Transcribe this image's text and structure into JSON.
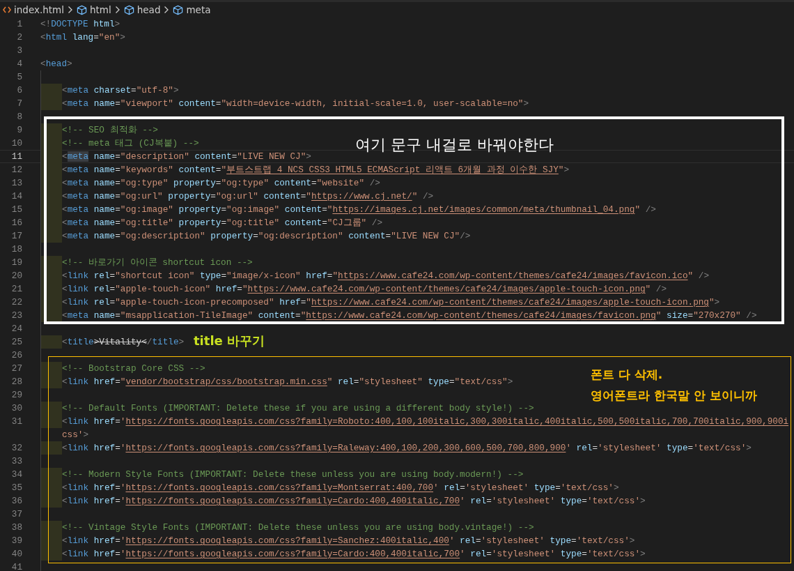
{
  "breadcrumb": [
    {
      "kind": "file",
      "label": "index.html"
    },
    {
      "kind": "element",
      "label": "html"
    },
    {
      "kind": "element",
      "label": "head"
    },
    {
      "kind": "element",
      "label": "meta"
    }
  ],
  "lines": [
    {
      "number": "1",
      "current": false,
      "indented": false,
      "tokens": [
        {
          "kind": "p",
          "text": "<!"
        },
        {
          "kind": "tag",
          "text": "DOCTYPE"
        },
        {
          "kind": "attr",
          "text": " html"
        },
        {
          "kind": "p",
          "text": ">"
        }
      ]
    },
    {
      "number": "2",
      "current": false,
      "indented": false,
      "tokens": [
        {
          "kind": "p",
          "text": "<"
        },
        {
          "kind": "tag",
          "text": "html"
        },
        {
          "kind": "attr",
          "text": " lang"
        },
        {
          "kind": "eq",
          "text": "="
        },
        {
          "kind": "str",
          "text": "\"en\""
        },
        {
          "kind": "p",
          "text": ">"
        }
      ]
    },
    {
      "number": "3",
      "current": false,
      "indented": false
    },
    {
      "number": "4",
      "current": false,
      "indented": false,
      "tokens": [
        {
          "kind": "p",
          "text": "<"
        },
        {
          "kind": "tag",
          "text": "head"
        },
        {
          "kind": "p",
          "text": ">"
        }
      ]
    },
    {
      "number": "5",
      "current": false,
      "indented": false
    },
    {
      "number": "6",
      "current": false,
      "indented": true,
      "tokens": [
        {
          "kind": "p",
          "text": "<"
        },
        {
          "kind": "tag",
          "text": "meta"
        },
        {
          "kind": "attr",
          "text": " charset"
        },
        {
          "kind": "eq",
          "text": "="
        },
        {
          "kind": "str",
          "text": "\"utf-8\""
        },
        {
          "kind": "p",
          "text": ">"
        }
      ]
    },
    {
      "number": "7",
      "current": false,
      "indented": true,
      "tokens": [
        {
          "kind": "p",
          "text": "<"
        },
        {
          "kind": "tag",
          "text": "meta"
        },
        {
          "kind": "attr",
          "text": " name"
        },
        {
          "kind": "eq",
          "text": "="
        },
        {
          "kind": "str",
          "text": "\"viewport\""
        },
        {
          "kind": "attr",
          "text": " content"
        },
        {
          "kind": "eq",
          "text": "="
        },
        {
          "kind": "str",
          "text": "\"width=device-width, initial-scale=1.0, user-scalable=no\""
        },
        {
          "kind": "p",
          "text": ">"
        }
      ]
    },
    {
      "number": "8",
      "current": false,
      "indented": false
    },
    {
      "number": "9",
      "current": false,
      "indented": true,
      "tokens": [
        {
          "kind": "com",
          "text": "<!-- SEO 최적화 -->"
        }
      ]
    },
    {
      "number": "10",
      "current": false,
      "indented": true,
      "tokens": [
        {
          "kind": "com",
          "text": "<!-- meta 태그 (CJ복붙) -->"
        }
      ]
    },
    {
      "number": "11",
      "current": true,
      "indented": true,
      "tokens": [
        {
          "kind": "p",
          "text": "<"
        },
        {
          "kind": "match",
          "text": "meta"
        },
        {
          "kind": "attr",
          "text": " name"
        },
        {
          "kind": "eq",
          "text": "="
        },
        {
          "kind": "str",
          "text": "\"description\""
        },
        {
          "kind": "attr",
          "text": " content"
        },
        {
          "kind": "eq",
          "text": "="
        },
        {
          "kind": "str",
          "text": "\"LIVE NEW CJ\""
        },
        {
          "kind": "p",
          "text": ">"
        }
      ]
    },
    {
      "number": "12",
      "current": false,
      "indented": true,
      "tokens": [
        {
          "kind": "p",
          "text": "<"
        },
        {
          "kind": "tag",
          "text": "meta"
        },
        {
          "kind": "attr",
          "text": " name"
        },
        {
          "kind": "eq",
          "text": "="
        },
        {
          "kind": "str",
          "text": "\"keywords\""
        },
        {
          "kind": "attr",
          "text": " content"
        },
        {
          "kind": "eq",
          "text": "="
        },
        {
          "kind": "str",
          "text": "\""
        },
        {
          "kind": "link",
          "text": "부트스트랩 4 NCS CSS3 HTML5 ECMAScript 리액트 6개월 과정 이수한 SJY"
        },
        {
          "kind": "str",
          "text": "\""
        },
        {
          "kind": "p",
          "text": ">"
        }
      ]
    },
    {
      "number": "13",
      "current": false,
      "indented": true,
      "tokens": [
        {
          "kind": "p",
          "text": "<"
        },
        {
          "kind": "tag",
          "text": "meta"
        },
        {
          "kind": "attr",
          "text": " name"
        },
        {
          "kind": "eq",
          "text": "="
        },
        {
          "kind": "str",
          "text": "\"og:type\""
        },
        {
          "kind": "attr",
          "text": " property"
        },
        {
          "kind": "eq",
          "text": "="
        },
        {
          "kind": "str",
          "text": "\"og:type\""
        },
        {
          "kind": "attr",
          "text": " content"
        },
        {
          "kind": "eq",
          "text": "="
        },
        {
          "kind": "str",
          "text": "\"website\""
        },
        {
          "kind": "p",
          "text": " />"
        }
      ]
    },
    {
      "number": "14",
      "current": false,
      "indented": true,
      "tokens": [
        {
          "kind": "p",
          "text": "<"
        },
        {
          "kind": "tag",
          "text": "meta"
        },
        {
          "kind": "attr",
          "text": " name"
        },
        {
          "kind": "eq",
          "text": "="
        },
        {
          "kind": "str",
          "text": "\"og:url\""
        },
        {
          "kind": "attr",
          "text": " property"
        },
        {
          "kind": "eq",
          "text": "="
        },
        {
          "kind": "str",
          "text": "\"og:url\""
        },
        {
          "kind": "attr",
          "text": " content"
        },
        {
          "kind": "eq",
          "text": "="
        },
        {
          "kind": "str",
          "text": "\""
        },
        {
          "kind": "link",
          "text": "https://www.cj.net/"
        },
        {
          "kind": "str",
          "text": "\""
        },
        {
          "kind": "p",
          "text": " />"
        }
      ]
    },
    {
      "number": "15",
      "current": false,
      "indented": true,
      "tokens": [
        {
          "kind": "p",
          "text": "<"
        },
        {
          "kind": "tag",
          "text": "meta"
        },
        {
          "kind": "attr",
          "text": " name"
        },
        {
          "kind": "eq",
          "text": "="
        },
        {
          "kind": "str",
          "text": "\"og:image\""
        },
        {
          "kind": "attr",
          "text": " property"
        },
        {
          "kind": "eq",
          "text": "="
        },
        {
          "kind": "str",
          "text": "\"og:image\""
        },
        {
          "kind": "attr",
          "text": " content"
        },
        {
          "kind": "eq",
          "text": "="
        },
        {
          "kind": "str",
          "text": "\""
        },
        {
          "kind": "link",
          "text": "https://images.cj.net/images/common/meta/thumbnail_04.png"
        },
        {
          "kind": "str",
          "text": "\""
        },
        {
          "kind": "p",
          "text": " />"
        }
      ]
    },
    {
      "number": "16",
      "current": false,
      "indented": true,
      "tokens": [
        {
          "kind": "p",
          "text": "<"
        },
        {
          "kind": "tag",
          "text": "meta"
        },
        {
          "kind": "attr",
          "text": " name"
        },
        {
          "kind": "eq",
          "text": "="
        },
        {
          "kind": "str",
          "text": "\"og:title\""
        },
        {
          "kind": "attr",
          "text": " property"
        },
        {
          "kind": "eq",
          "text": "="
        },
        {
          "kind": "str",
          "text": "\"og:title\""
        },
        {
          "kind": "attr",
          "text": " content"
        },
        {
          "kind": "eq",
          "text": "="
        },
        {
          "kind": "str",
          "text": "\"CJ그룹\""
        },
        {
          "kind": "p",
          "text": " />"
        }
      ]
    },
    {
      "number": "17",
      "current": false,
      "indented": true,
      "tokens": [
        {
          "kind": "p",
          "text": "<"
        },
        {
          "kind": "tag",
          "text": "meta"
        },
        {
          "kind": "attr",
          "text": " name"
        },
        {
          "kind": "eq",
          "text": "="
        },
        {
          "kind": "str",
          "text": "\"og:description\""
        },
        {
          "kind": "attr",
          "text": " property"
        },
        {
          "kind": "eq",
          "text": "="
        },
        {
          "kind": "str",
          "text": "\"og:description\""
        },
        {
          "kind": "attr",
          "text": " content"
        },
        {
          "kind": "eq",
          "text": "="
        },
        {
          "kind": "str",
          "text": "\"LIVE NEW CJ\""
        },
        {
          "kind": "p",
          "text": "/>"
        }
      ]
    },
    {
      "number": "18",
      "current": false,
      "indented": false
    },
    {
      "number": "19",
      "current": false,
      "indented": true,
      "tokens": [
        {
          "kind": "com",
          "text": "<!-- 바로가기 아이콘 shortcut icon -->"
        }
      ]
    },
    {
      "number": "20",
      "current": false,
      "indented": true,
      "tokens": [
        {
          "kind": "p",
          "text": "<"
        },
        {
          "kind": "tag",
          "text": "link"
        },
        {
          "kind": "attr",
          "text": " rel"
        },
        {
          "kind": "eq",
          "text": "="
        },
        {
          "kind": "str",
          "text": "\"shortcut icon\""
        },
        {
          "kind": "attr",
          "text": " type"
        },
        {
          "kind": "eq",
          "text": "="
        },
        {
          "kind": "str",
          "text": "\"image/x-icon\""
        },
        {
          "kind": "attr",
          "text": " href"
        },
        {
          "kind": "eq",
          "text": "="
        },
        {
          "kind": "str",
          "text": "\""
        },
        {
          "kind": "link",
          "text": "https://www.cafe24.com/wp-content/themes/cafe24/images/favicon.ico"
        },
        {
          "kind": "str",
          "text": "\""
        },
        {
          "kind": "p",
          "text": " />"
        }
      ]
    },
    {
      "number": "21",
      "current": false,
      "indented": true,
      "tokens": [
        {
          "kind": "p",
          "text": "<"
        },
        {
          "kind": "tag",
          "text": "link"
        },
        {
          "kind": "attr",
          "text": " rel"
        },
        {
          "kind": "eq",
          "text": "="
        },
        {
          "kind": "str",
          "text": "\"apple-touch-icon\""
        },
        {
          "kind": "attr",
          "text": " href"
        },
        {
          "kind": "eq",
          "text": "="
        },
        {
          "kind": "str",
          "text": "\""
        },
        {
          "kind": "link",
          "text": "https://www.cafe24.com/wp-content/themes/cafe24/images/apple-touch-icon.png"
        },
        {
          "kind": "str",
          "text": "\""
        },
        {
          "kind": "p",
          "text": " />"
        }
      ]
    },
    {
      "number": "22",
      "current": false,
      "indented": true,
      "tokens": [
        {
          "kind": "p",
          "text": "<"
        },
        {
          "kind": "tag",
          "text": "link"
        },
        {
          "kind": "attr",
          "text": " rel"
        },
        {
          "kind": "eq",
          "text": "="
        },
        {
          "kind": "str",
          "text": "\"apple-touch-icon-precomposed\""
        },
        {
          "kind": "attr",
          "text": " href"
        },
        {
          "kind": "eq",
          "text": "="
        },
        {
          "kind": "str",
          "text": "\""
        },
        {
          "kind": "link",
          "text": "https://www.cafe24.com/wp-content/themes/cafe24/images/apple-touch-icon.png"
        },
        {
          "kind": "str",
          "text": "\""
        },
        {
          "kind": "p",
          "text": ">"
        }
      ]
    },
    {
      "number": "23",
      "current": false,
      "indented": true,
      "tokens": [
        {
          "kind": "p",
          "text": "<"
        },
        {
          "kind": "tag",
          "text": "meta"
        },
        {
          "kind": "attr",
          "text": " name"
        },
        {
          "kind": "eq",
          "text": "="
        },
        {
          "kind": "str",
          "text": "\"msapplication-TileImage\""
        },
        {
          "kind": "attr",
          "text": " content"
        },
        {
          "kind": "eq",
          "text": "="
        },
        {
          "kind": "str",
          "text": "\""
        },
        {
          "kind": "link",
          "text": "https://www.cafe24.com/wp-content/themes/cafe24/images/favicon.png"
        },
        {
          "kind": "str",
          "text": "\""
        },
        {
          "kind": "attr",
          "text": " size"
        },
        {
          "kind": "eq",
          "text": "="
        },
        {
          "kind": "str",
          "text": "\"270x270\""
        },
        {
          "kind": "p",
          "text": " />"
        }
      ]
    },
    {
      "number": "24",
      "current": false,
      "indented": false
    },
    {
      "number": "25",
      "current": false,
      "indented": true,
      "tokens": [
        {
          "kind": "p",
          "text": "<"
        },
        {
          "kind": "tag",
          "text": "title"
        },
        {
          "kind": "strike",
          "text": ">Vitality<"
        },
        {
          "kind": "p",
          "text": "/"
        },
        {
          "kind": "tag",
          "text": "title"
        },
        {
          "kind": "p",
          "text": ">"
        }
      ]
    },
    {
      "number": "26",
      "current": false,
      "indented": false
    },
    {
      "number": "27",
      "current": false,
      "indented": true,
      "tokens": [
        {
          "kind": "com",
          "text": "<!-- Bootstrap Core CSS -->"
        }
      ]
    },
    {
      "number": "28",
      "current": false,
      "indented": true,
      "tokens": [
        {
          "kind": "p",
          "text": "<"
        },
        {
          "kind": "tag",
          "text": "link"
        },
        {
          "kind": "attr",
          "text": " href"
        },
        {
          "kind": "eq",
          "text": "="
        },
        {
          "kind": "str",
          "text": "\""
        },
        {
          "kind": "link",
          "text": "vendor/bootstrap/css/bootstrap.min.css"
        },
        {
          "kind": "str",
          "text": "\""
        },
        {
          "kind": "attr",
          "text": " rel"
        },
        {
          "kind": "eq",
          "text": "="
        },
        {
          "kind": "str",
          "text": "\"stylesheet\""
        },
        {
          "kind": "attr",
          "text": " type"
        },
        {
          "kind": "eq",
          "text": "="
        },
        {
          "kind": "str",
          "text": "\"text/css\""
        },
        {
          "kind": "p",
          "text": ">"
        }
      ]
    },
    {
      "number": "29",
      "current": false,
      "indented": false
    },
    {
      "number": "30",
      "current": false,
      "indented": true,
      "tokens": [
        {
          "kind": "com",
          "text": "<!-- Default Fonts (IMPORTANT: Delete these if you are using a different body style!) -->"
        }
      ]
    },
    {
      "number": "31",
      "current": false,
      "indented": true,
      "tokens": [
        {
          "kind": "p",
          "text": "<"
        },
        {
          "kind": "tag",
          "text": "link"
        },
        {
          "kind": "attr",
          "text": " href"
        },
        {
          "kind": "eq",
          "text": "="
        },
        {
          "kind": "str",
          "text": "'"
        },
        {
          "kind": "link",
          "text": "https://fonts.googleapis.com/css?family=Roboto:400,100,100italic,300,300italic,400italic,500,500italic,700,700italic,900,900i"
        }
      ],
      "wrap": [
        {
          "kind": "str",
          "text": "css'"
        },
        {
          "kind": "p",
          "text": ">"
        }
      ]
    },
    {
      "number": "32",
      "current": false,
      "indented": true,
      "tokens": [
        {
          "kind": "p",
          "text": "<"
        },
        {
          "kind": "tag",
          "text": "link"
        },
        {
          "kind": "attr",
          "text": " href"
        },
        {
          "kind": "eq",
          "text": "="
        },
        {
          "kind": "str",
          "text": "'"
        },
        {
          "kind": "link",
          "text": "https://fonts.googleapis.com/css?family=Raleway:400,100,200,300,600,500,700,800,900"
        },
        {
          "kind": "str",
          "text": "'"
        },
        {
          "kind": "attr",
          "text": " rel"
        },
        {
          "kind": "eq",
          "text": "="
        },
        {
          "kind": "str",
          "text": "'stylesheet'"
        },
        {
          "kind": "attr",
          "text": " type"
        },
        {
          "kind": "eq",
          "text": "="
        },
        {
          "kind": "str",
          "text": "'text/css'"
        },
        {
          "kind": "p",
          "text": ">"
        }
      ]
    },
    {
      "number": "33",
      "current": false,
      "indented": false
    },
    {
      "number": "34",
      "current": false,
      "indented": true,
      "tokens": [
        {
          "kind": "com",
          "text": "<!-- Modern Style Fonts (IMPORTANT: Delete these unless you are using body.modern!) -->"
        }
      ]
    },
    {
      "number": "35",
      "current": false,
      "indented": true,
      "tokens": [
        {
          "kind": "p",
          "text": "<"
        },
        {
          "kind": "tag",
          "text": "link"
        },
        {
          "kind": "attr",
          "text": " href"
        },
        {
          "kind": "eq",
          "text": "="
        },
        {
          "kind": "str",
          "text": "'"
        },
        {
          "kind": "link",
          "text": "https://fonts.googleapis.com/css?family=Montserrat:400,700"
        },
        {
          "kind": "str",
          "text": "'"
        },
        {
          "kind": "attr",
          "text": " rel"
        },
        {
          "kind": "eq",
          "text": "="
        },
        {
          "kind": "str",
          "text": "'stylesheet'"
        },
        {
          "kind": "attr",
          "text": " type"
        },
        {
          "kind": "eq",
          "text": "="
        },
        {
          "kind": "str",
          "text": "'text/css'"
        },
        {
          "kind": "p",
          "text": ">"
        }
      ]
    },
    {
      "number": "36",
      "current": false,
      "indented": true,
      "tokens": [
        {
          "kind": "p",
          "text": "<"
        },
        {
          "kind": "tag",
          "text": "link"
        },
        {
          "kind": "attr",
          "text": " href"
        },
        {
          "kind": "eq",
          "text": "="
        },
        {
          "kind": "str",
          "text": "'"
        },
        {
          "kind": "link",
          "text": "https://fonts.googleapis.com/css?family=Cardo:400,400italic,700"
        },
        {
          "kind": "str",
          "text": "'"
        },
        {
          "kind": "attr",
          "text": " rel"
        },
        {
          "kind": "eq",
          "text": "="
        },
        {
          "kind": "str",
          "text": "'stylesheet'"
        },
        {
          "kind": "attr",
          "text": " type"
        },
        {
          "kind": "eq",
          "text": "="
        },
        {
          "kind": "str",
          "text": "'text/css'"
        },
        {
          "kind": "p",
          "text": ">"
        }
      ]
    },
    {
      "number": "37",
      "current": false,
      "indented": false
    },
    {
      "number": "38",
      "current": false,
      "indented": true,
      "tokens": [
        {
          "kind": "com",
          "text": "<!-- Vintage Style Fonts (IMPORTANT: Delete these unless you are using body.vintage!) -->"
        }
      ]
    },
    {
      "number": "39",
      "current": false,
      "indented": true,
      "tokens": [
        {
          "kind": "p",
          "text": "<"
        },
        {
          "kind": "tag",
          "text": "link"
        },
        {
          "kind": "attr",
          "text": " href"
        },
        {
          "kind": "eq",
          "text": "="
        },
        {
          "kind": "str",
          "text": "'"
        },
        {
          "kind": "link",
          "text": "https://fonts.googleapis.com/css?family=Sanchez:400italic,400"
        },
        {
          "kind": "str",
          "text": "'"
        },
        {
          "kind": "attr",
          "text": " rel"
        },
        {
          "kind": "eq",
          "text": "="
        },
        {
          "kind": "str",
          "text": "'stylesheet'"
        },
        {
          "kind": "attr",
          "text": " type"
        },
        {
          "kind": "eq",
          "text": "="
        },
        {
          "kind": "str",
          "text": "'text/css'"
        },
        {
          "kind": "p",
          "text": ">"
        }
      ]
    },
    {
      "number": "40",
      "current": false,
      "indented": true,
      "tokens": [
        {
          "kind": "p",
          "text": "<"
        },
        {
          "kind": "tag",
          "text": "link"
        },
        {
          "kind": "attr",
          "text": " href"
        },
        {
          "kind": "eq",
          "text": "="
        },
        {
          "kind": "str",
          "text": "'"
        },
        {
          "kind": "link",
          "text": "https://fonts.googleapis.com/css?family=Cardo:400,400italic,700"
        },
        {
          "kind": "str",
          "text": "'"
        },
        {
          "kind": "attr",
          "text": " rel"
        },
        {
          "kind": "eq",
          "text": "="
        },
        {
          "kind": "str",
          "text": "'stylesheet'"
        },
        {
          "kind": "attr",
          "text": " type"
        },
        {
          "kind": "eq",
          "text": "="
        },
        {
          "kind": "str",
          "text": "'text/css'"
        },
        {
          "kind": "p",
          "text": ">"
        }
      ]
    },
    {
      "number": "41",
      "current": false,
      "indented": false
    }
  ],
  "annotations": [
    {
      "kind": "boxed",
      "color": "#ffffff",
      "lines": [
        "여기 문구 내걸로 바꿔야한다"
      ]
    },
    {
      "kind": "plain",
      "color": "#c8e021",
      "lines": [
        "title 바꾸기"
      ]
    },
    {
      "kind": "boxed",
      "color": "#ffc000",
      "lines": [
        "폰트 다 삭제.",
        "영어폰트라 한국말 안 보이니까"
      ]
    }
  ]
}
